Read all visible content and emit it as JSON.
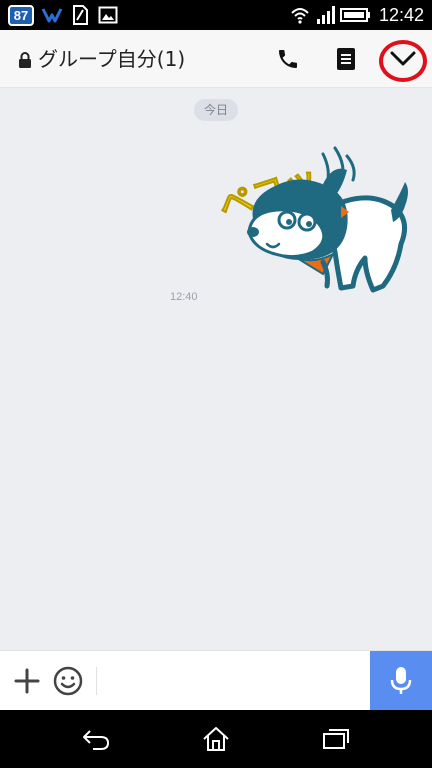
{
  "status_bar": {
    "badge": "87",
    "time": "12:42",
    "icons": [
      "line-notification-icon",
      "bluetooth-icon",
      "sim-icon",
      "image-icon",
      "wifi-icon",
      "signal-icon",
      "battery-icon"
    ]
  },
  "header": {
    "title": "グループ自分(1)",
    "icons": [
      "lock-icon",
      "phone-icon",
      "notes-icon",
      "chevron-down-icon"
    ],
    "highlight_color": "#e0101a"
  },
  "chat": {
    "date_label": "今日",
    "sticker_text": "ペコッ",
    "message_time": "12:40"
  },
  "input_bar": {
    "placeholder": "",
    "icons": [
      "plus-icon",
      "emoji-icon",
      "mic-icon"
    ],
    "mic_color": "#5a8df0"
  },
  "nav_bar": {
    "icons": [
      "back-icon",
      "home-icon",
      "recents-icon"
    ]
  },
  "colors": {
    "chat_background": "#edeef2",
    "sticker_teal": "#1f6a80",
    "sticker_yellow": "#f5d40a",
    "sticker_orange": "#ef6c15"
  }
}
